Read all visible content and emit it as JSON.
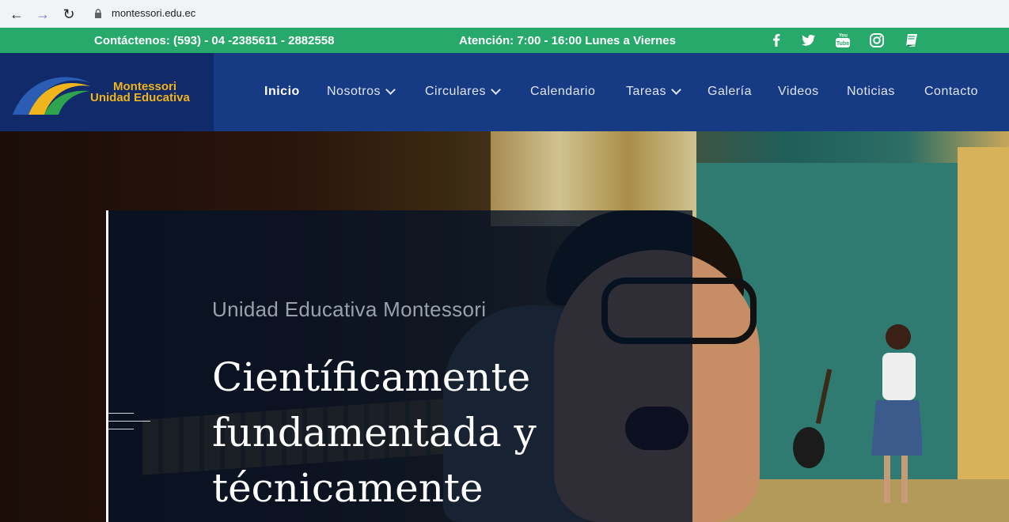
{
  "browser": {
    "url": "montessori.edu.ec",
    "icons": [
      "back-arrow-icon",
      "forward-arrow-icon",
      "reload-icon",
      "lock-icon"
    ]
  },
  "topbar": {
    "contact": "Contáctenos: (593) - 04 -2385611 - 2882558",
    "hours": "Atención: 7:00 - 16:00 Lunes a Viernes",
    "social_icons": [
      "facebook-icon",
      "twitter-icon",
      "youtube-icon",
      "instagram-icon",
      "book-icon"
    ],
    "color": "#26a96a"
  },
  "header": {
    "logo_line1": "Montessori",
    "logo_line2": "Unidad Educativa",
    "color": "#163a84",
    "menu": [
      {
        "label": "Inicio",
        "active": true
      },
      {
        "label": "Nosotros",
        "dropdown": true
      },
      {
        "label": "Circulares",
        "dropdown": true
      },
      {
        "label": "Calendario"
      },
      {
        "label": "Tareas",
        "dropdown": true
      },
      {
        "label": "Galería"
      },
      {
        "label": "Videos"
      },
      {
        "label": "Noticias"
      },
      {
        "label": "Contacto"
      }
    ]
  },
  "hero": {
    "subtitle": "Unidad Educativa Montessori",
    "title_lines": [
      "Científicamente",
      "fundamentada y",
      "técnicamente"
    ]
  }
}
